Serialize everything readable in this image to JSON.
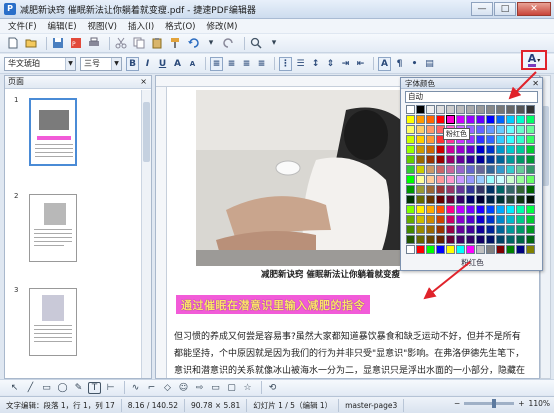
{
  "window": {
    "title": "减肥新诀窍 催眠新法让你躺着就变瘦.pdf - 捷速PDF编辑器",
    "minimize": "—",
    "maximize": "□",
    "close": "✕"
  },
  "menu": {
    "items": [
      "文件(F)",
      "编辑(E)",
      "视图(V)",
      "插入(I)",
      "格式(O)",
      "修改(M)"
    ]
  },
  "format_toolbar": {
    "font_family": "华文琥珀",
    "font_size": "三号",
    "bold": "B",
    "italic": "I",
    "underline": "U"
  },
  "sidebar": {
    "title": "页面",
    "close": "×",
    "pages": [
      {
        "number": "1",
        "active": true
      },
      {
        "number": "2",
        "active": false
      },
      {
        "number": "3",
        "active": false
      }
    ]
  },
  "document": {
    "caption": "减肥新诀窍 催眠新法让你躺着就变瘦",
    "heading": "通过催眠在潜意识里输入减肥的指令",
    "paragraph_lines": [
      "但习惯的养成又何尝是容易事?虽然大家都知道暴饮暴食和缺乏运动不好，但并不是所有",
      "都能坚持，个中原因就是因为我们的行为并非只受\"显意识\"影响。在弗洛伊德先生笔下，",
      "意识和潜意识的关系就像冰山被海水一分为二，显意识只是浮出水面的一小部分，隐藏在"
    ]
  },
  "font_color_palette": {
    "title": "字体颜色",
    "auto_label": "自动",
    "tooltip": "粉红色",
    "footer": "粉红色",
    "selected_color": "#ff00cc",
    "colors": [
      "#ffffff",
      "#000000",
      "#eeeeee",
      "#dddddd",
      "#cccccc",
      "#bbbbbb",
      "#aaaaaa",
      "#999999",
      "#888888",
      "#777777",
      "#666666",
      "#555555",
      "#333333",
      "#ffff00",
      "#ff9900",
      "#ff6600",
      "#ff0000",
      "#ff00cc",
      "#cc00ff",
      "#9900ff",
      "#6600ff",
      "#0000ff",
      "#0066ff",
      "#00ccff",
      "#00ffcc",
      "#00ff66",
      "#ffff66",
      "#ffcc66",
      "#ff9966",
      "#ff6666",
      "#ff66cc",
      "#cc66ff",
      "#9966ff",
      "#6666ff",
      "#6699ff",
      "#66ccff",
      "#66ffff",
      "#66ffcc",
      "#66ff99",
      "#ccff00",
      "#ffcc00",
      "#ff9933",
      "#ff3333",
      "#ff3399",
      "#cc33ff",
      "#9933ff",
      "#3333ff",
      "#3366ff",
      "#33ccff",
      "#33ffff",
      "#33ffcc",
      "#33ff66",
      "#99ff00",
      "#cc9900",
      "#cc6600",
      "#cc0000",
      "#cc0099",
      "#9900cc",
      "#6600cc",
      "#0000cc",
      "#0033cc",
      "#0099cc",
      "#00cccc",
      "#00cc99",
      "#00cc33",
      "#66cc00",
      "#996600",
      "#993300",
      "#990000",
      "#990066",
      "#660099",
      "#330099",
      "#000099",
      "#003399",
      "#006699",
      "#009999",
      "#009966",
      "#009933",
      "#33cc33",
      "#cccc00",
      "#cc9966",
      "#cc6666",
      "#cc6699",
      "#9966cc",
      "#6666cc",
      "#666699",
      "#336699",
      "#3399cc",
      "#33cccc",
      "#66cc99",
      "#339966",
      "#00ff00",
      "#ffff99",
      "#ffcc99",
      "#ff9999",
      "#ff99cc",
      "#cc99ff",
      "#9999ff",
      "#99ccff",
      "#99ffff",
      "#ccffff",
      "#ccffcc",
      "#99ff99",
      "#66ff66",
      "#009900",
      "#999933",
      "#996633",
      "#993333",
      "#993366",
      "#663399",
      "#333399",
      "#333366",
      "#003366",
      "#006666",
      "#336666",
      "#336633",
      "#006600",
      "#003300",
      "#666600",
      "#663300",
      "#660000",
      "#660033",
      "#330066",
      "#000066",
      "#000033",
      "#002244",
      "#003333",
      "#224433",
      "#113311",
      "#001100",
      "#80ff00",
      "#ffee00",
      "#ffaa00",
      "#ff5500",
      "#ff0088",
      "#bb00ff",
      "#7700ff",
      "#2200ff",
      "#0044ff",
      "#00aaff",
      "#00eeff",
      "#00ffaa",
      "#00ff44",
      "#66aa00",
      "#ccbb00",
      "#cc8800",
      "#cc4400",
      "#cc0066",
      "#8800cc",
      "#5500cc",
      "#1100cc",
      "#0033cc",
      "#0088cc",
      "#00bbcc",
      "#00cc88",
      "#00cc33",
      "#448800",
      "#998800",
      "#996600",
      "#993300",
      "#990044",
      "#660099",
      "#440099",
      "#110099",
      "#002299",
      "#006699",
      "#009999",
      "#009966",
      "#009922",
      "#225500",
      "#666600",
      "#664400",
      "#662200",
      "#660033",
      "#440066",
      "#330066",
      "#110066",
      "#001166",
      "#004466",
      "#006666",
      "#006644",
      "#006611",
      "#ffffff",
      "#ff0000",
      "#00ff00",
      "#0000ff",
      "#ffff00",
      "#00ffff",
      "#ff00ff",
      "#c0c0c0",
      "#808080",
      "#800000",
      "#008000",
      "#000080",
      "#808000"
    ]
  },
  "statusbar": {
    "mode": "文字编辑：段落 1，行 1，列 17",
    "position": "8.16 / 140.52",
    "size": "90.78 × 5.81",
    "page": "幻灯片 1 / 5（编辑 1）",
    "layout": "master-page3",
    "zoom": "110%"
  }
}
